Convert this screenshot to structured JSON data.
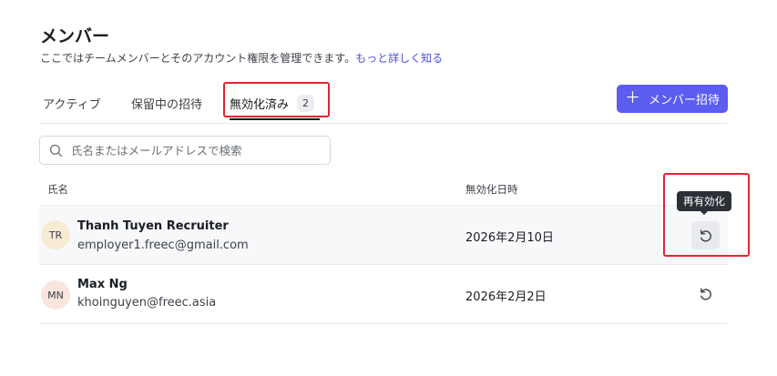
{
  "header": {
    "title": "メンバー",
    "subtitle": "ここではチームメンバーとそのアカウント権限を管理できます。",
    "learn_more": "もっと詳しく知る"
  },
  "tabs": [
    {
      "label": "アクティブ"
    },
    {
      "label": "保留中の招待"
    },
    {
      "label": "無効化済み",
      "count": "2",
      "active": true
    }
  ],
  "invite_button": {
    "label": "メンバー招待",
    "icon": "plus-icon"
  },
  "search": {
    "placeholder": "氏名またはメールアドレスで検索",
    "value": "",
    "icon": "search-icon"
  },
  "table": {
    "columns": {
      "name": "氏名",
      "date": "無効化日時"
    },
    "rows": [
      {
        "initials": "TR",
        "name": "Thanh Tuyen Recruiter",
        "email": "employer1.freec@gmail.com",
        "date": "2026年2月10日",
        "action_icon": "restore-icon"
      },
      {
        "initials": "MN",
        "name": "Max Ng",
        "email": "khoinguyen@freec.asia",
        "date": "2026年2月2日",
        "action_icon": "restore-icon"
      }
    ]
  },
  "tooltip": {
    "text": "再有効化"
  },
  "colors": {
    "accent": "#5b5cf0",
    "link": "#4f53d8",
    "highlight": "#e0262f"
  }
}
